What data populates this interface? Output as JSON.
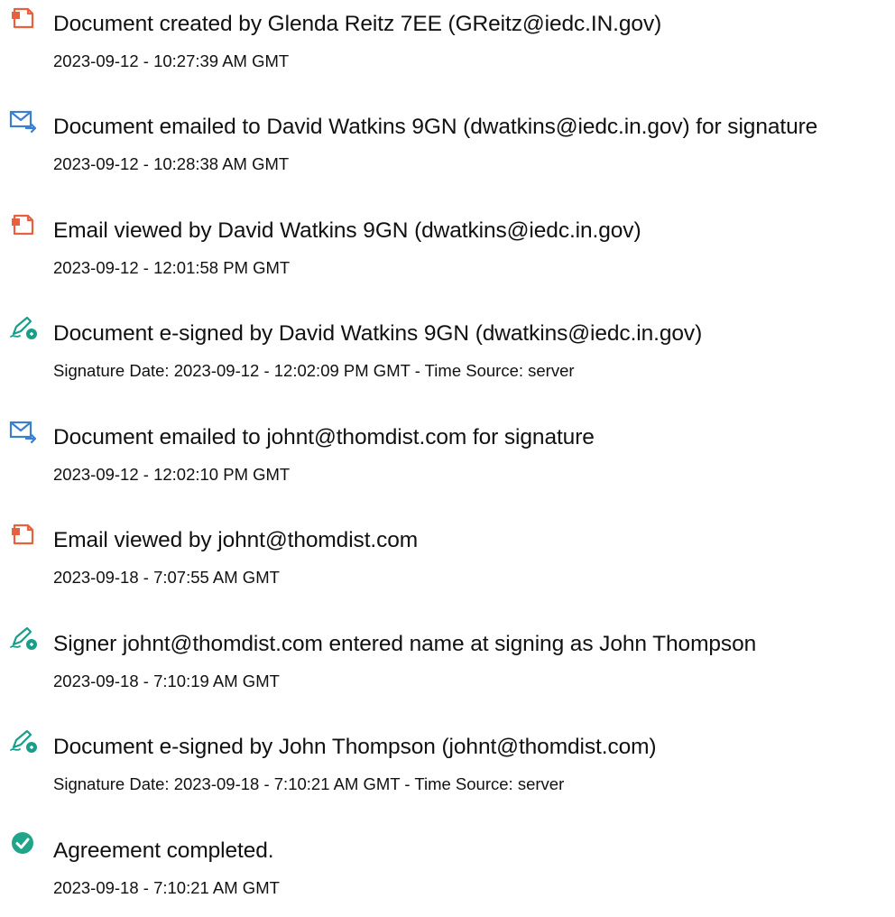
{
  "colors": {
    "document_icon": "#e8603c",
    "email_icon": "#3b7fd1",
    "sign_icon": "#1a9e8a",
    "complete_icon": "#20a58a"
  },
  "events": [
    {
      "icon": "document-icon",
      "title": "Document created by Glenda Reitz 7EE (GReitz@iedc.IN.gov)",
      "detail": "2023-09-12 - 10:27:39 AM GMT"
    },
    {
      "icon": "email-sent-icon",
      "title": "Document emailed to David Watkins 9GN (dwatkins@iedc.in.gov) for signature",
      "detail": "2023-09-12 - 10:28:38 AM GMT"
    },
    {
      "icon": "document-icon",
      "title": "Email viewed by David Watkins 9GN (dwatkins@iedc.in.gov)",
      "detail": "2023-09-12 - 12:01:58 PM GMT"
    },
    {
      "icon": "esign-pen-icon",
      "title": "Document e-signed by David Watkins 9GN (dwatkins@iedc.in.gov)",
      "detail": "Signature Date: 2023-09-12 - 12:02:09 PM GMT - Time Source: server"
    },
    {
      "icon": "email-sent-icon",
      "title": "Document emailed to johnt@thomdist.com for signature",
      "detail": "2023-09-12 - 12:02:10 PM GMT"
    },
    {
      "icon": "document-icon",
      "title": "Email viewed by johnt@thomdist.com",
      "detail": "2023-09-18 - 7:07:55 AM GMT"
    },
    {
      "icon": "esign-pen-icon",
      "title": "Signer johnt@thomdist.com entered name at signing as John Thompson",
      "detail": "2023-09-18 - 7:10:19 AM GMT"
    },
    {
      "icon": "esign-pen-icon",
      "title": "Document e-signed by John Thompson (johnt@thomdist.com)",
      "detail": "Signature Date: 2023-09-18 - 7:10:21 AM GMT - Time Source: server"
    },
    {
      "icon": "check-circle-icon",
      "title": "Agreement completed.",
      "detail": "2023-09-18 - 7:10:21 AM GMT"
    }
  ]
}
